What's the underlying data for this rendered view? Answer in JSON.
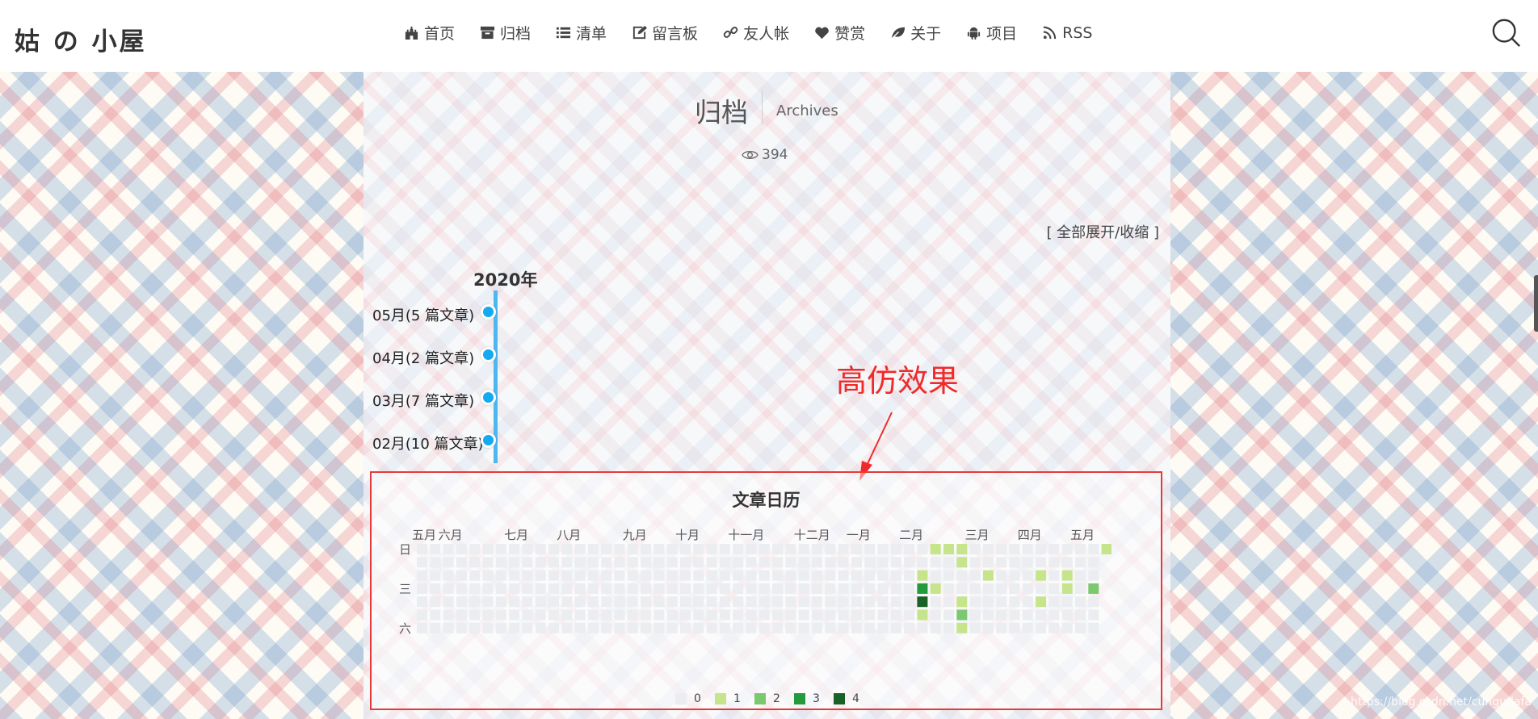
{
  "header": {
    "logo": "姑 の 小屋",
    "nav": [
      {
        "icon": "castle-icon",
        "label": "首页"
      },
      {
        "icon": "archive-box-icon",
        "label": "归档"
      },
      {
        "icon": "list-icon",
        "label": "清单"
      },
      {
        "icon": "edit-icon",
        "label": "留言板"
      },
      {
        "icon": "link-icon",
        "label": "友人帐"
      },
      {
        "icon": "heart-icon",
        "label": "赞赏"
      },
      {
        "icon": "leaf-icon",
        "label": "关于"
      },
      {
        "icon": "android-icon",
        "label": "项目"
      },
      {
        "icon": "rss-icon",
        "label": "RSS"
      }
    ],
    "search_icon": "search-icon"
  },
  "page": {
    "title": "归档",
    "subtitle": "Archives",
    "views": "394",
    "expand_toggle": "[ 全部展开/收缩 ]",
    "year": "2020年",
    "months": [
      {
        "label": "05月(5 篇文章)"
      },
      {
        "label": "04月(2 篇文章)"
      },
      {
        "label": "03月(7 篇文章)"
      },
      {
        "label": "02月(10 篇文章)"
      }
    ]
  },
  "annotation": {
    "text": "高仿效果",
    "color": "#f02a2a"
  },
  "chart_data": {
    "type": "heatmap",
    "title": "文章日历",
    "x_ticks": [
      "五月",
      "六月",
      "七月",
      "八月",
      "九月",
      "十月",
      "十一月",
      "十二月",
      "一月",
      "二月",
      "三月",
      "四月",
      "五月"
    ],
    "y_ticks": [
      "日",
      "三",
      "六"
    ],
    "weeks": 53,
    "days_per_week": 7,
    "legend": [
      {
        "label": "0",
        "color": "#ebedf0"
      },
      {
        "label": "1",
        "color": "#c6e48b"
      },
      {
        "label": "2",
        "color": "#7bc96f"
      },
      {
        "label": "3",
        "color": "#239a3b"
      },
      {
        "label": "4",
        "color": "#196127"
      }
    ],
    "cells": [
      {
        "week": 38,
        "day": 2,
        "value": 1
      },
      {
        "week": 38,
        "day": 3,
        "value": 3
      },
      {
        "week": 38,
        "day": 4,
        "value": 4
      },
      {
        "week": 38,
        "day": 5,
        "value": 1
      },
      {
        "week": 39,
        "day": 0,
        "value": 1
      },
      {
        "week": 39,
        "day": 3,
        "value": 1
      },
      {
        "week": 40,
        "day": 0,
        "value": 1
      },
      {
        "week": 41,
        "day": 0,
        "value": 1
      },
      {
        "week": 41,
        "day": 1,
        "value": 1
      },
      {
        "week": 41,
        "day": 4,
        "value": 1
      },
      {
        "week": 41,
        "day": 5,
        "value": 2
      },
      {
        "week": 41,
        "day": 6,
        "value": 1
      },
      {
        "week": 43,
        "day": 2,
        "value": 1
      },
      {
        "week": 47,
        "day": 2,
        "value": 1
      },
      {
        "week": 47,
        "day": 4,
        "value": 1
      },
      {
        "week": 49,
        "day": 2,
        "value": 1
      },
      {
        "week": 49,
        "day": 3,
        "value": 1
      },
      {
        "week": 51,
        "day": 3,
        "value": 2
      },
      {
        "week": 52,
        "day": 0,
        "value": 1
      }
    ],
    "last_week_days": 1
  },
  "watermark": "https://blog.csdn.net/cungudafa"
}
